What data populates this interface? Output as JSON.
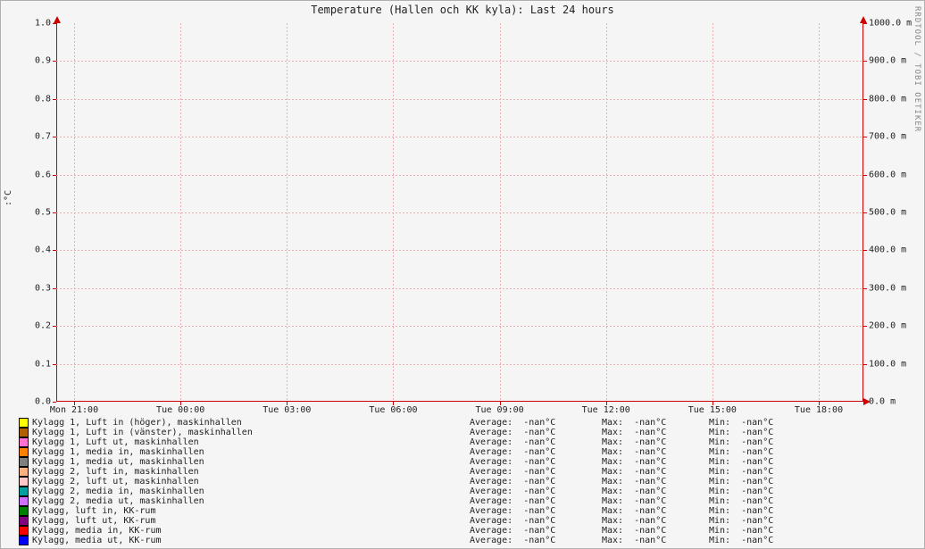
{
  "title": "Temperature (Hallen och KK kyla): Last 24 hours",
  "ylabel": ":°C",
  "watermark": "RRDTOOL / TOBI OETIKER",
  "y_left": [
    "0.0",
    "0.1",
    "0.2",
    "0.3",
    "0.4",
    "0.5",
    "0.6",
    "0.7",
    "0.8",
    "0.9",
    "1.0"
  ],
  "y_right": [
    "0.0 m",
    "100.0 m",
    "200.0 m",
    "300.0 m",
    "400.0 m",
    "500.0 m",
    "600.0 m",
    "700.0 m",
    "800.0 m",
    "900.0 m",
    "1000.0 m"
  ],
  "x_ticks": [
    "Mon 21:00",
    "Tue 00:00",
    "Tue 03:00",
    "Tue 06:00",
    "Tue 09:00",
    "Tue 12:00",
    "Tue 15:00",
    "Tue 18:00"
  ],
  "stat_headers": {
    "avg": "Average:",
    "max": "Max:",
    "min": "Min:"
  },
  "series": [
    {
      "color": "#ffff00",
      "name": "Kylagg 1, Luft in (höger), maskinhallen",
      "avg": "-nan°C",
      "max": "-nan°C",
      "min": "-nan°C"
    },
    {
      "color": "#b06000",
      "name": "Kylagg 1, Luft in (vänster), maskinhallen",
      "avg": "-nan°C",
      "max": "-nan°C",
      "min": "-nan°C"
    },
    {
      "color": "#ff70d0",
      "name": "Kylagg 1, Luft ut, maskinhallen",
      "avg": "-nan°C",
      "max": "-nan°C",
      "min": "-nan°C"
    },
    {
      "color": "#ff8000",
      "name": "Kylagg 1, media in, maskinhallen",
      "avg": "-nan°C",
      "max": "-nan°C",
      "min": "-nan°C"
    },
    {
      "color": "#808080",
      "name": "Kylagg 1, media ut, maskinhallen",
      "avg": "-nan°C",
      "max": "-nan°C",
      "min": "-nan°C"
    },
    {
      "color": "#ffb080",
      "name": "Kylagg 2, luft in, maskinhallen",
      "avg": "-nan°C",
      "max": "-nan°C",
      "min": "-nan°C"
    },
    {
      "color": "#ffc8c8",
      "name": "Kylagg 2, luft ut, maskinhallen",
      "avg": "-nan°C",
      "max": "-nan°C",
      "min": "-nan°C"
    },
    {
      "color": "#00a0a0",
      "name": "Kylagg 2, media in, maskinhallen",
      "avg": "-nan°C",
      "max": "-nan°C",
      "min": "-nan°C"
    },
    {
      "color": "#d070ff",
      "name": "Kylagg 2, media ut, maskinhallen",
      "avg": "-nan°C",
      "max": "-nan°C",
      "min": "-nan°C"
    },
    {
      "color": "#008000",
      "name": "Kylagg, luft in, KK-rum",
      "avg": "-nan°C",
      "max": "-nan°C",
      "min": "-nan°C"
    },
    {
      "color": "#800080",
      "name": "Kylagg, luft ut, KK-rum",
      "avg": "-nan°C",
      "max": "-nan°C",
      "min": "-nan°C"
    },
    {
      "color": "#ff0000",
      "name": "Kylagg, media in, KK-rum",
      "avg": "-nan°C",
      "max": "-nan°C",
      "min": "-nan°C"
    },
    {
      "color": "#0000ff",
      "name": "Kylagg, media ut, KK-rum",
      "avg": "-nan°C",
      "max": "-nan°C",
      "min": "-nan°C"
    }
  ],
  "chart_data": {
    "type": "line",
    "title": "Temperature (Hallen och KK kyla): Last 24 hours",
    "xlabel": "",
    "ylabel": ":°C",
    "x_categories": [
      "Mon 21:00",
      "Tue 00:00",
      "Tue 03:00",
      "Tue 06:00",
      "Tue 09:00",
      "Tue 12:00",
      "Tue 15:00",
      "Tue 18:00"
    ],
    "ylim_left": [
      0.0,
      1.0
    ],
    "ylim_right_label_suffix": " m",
    "ylim_right": [
      0.0,
      1000.0
    ],
    "series": [
      {
        "name": "Kylagg 1, Luft in (höger), maskinhallen",
        "values": null,
        "average": "-nan",
        "max": "-nan",
        "min": "-nan",
        "unit": "°C"
      },
      {
        "name": "Kylagg 1, Luft in (vänster), maskinhallen",
        "values": null,
        "average": "-nan",
        "max": "-nan",
        "min": "-nan",
        "unit": "°C"
      },
      {
        "name": "Kylagg 1, Luft ut, maskinhallen",
        "values": null,
        "average": "-nan",
        "max": "-nan",
        "min": "-nan",
        "unit": "°C"
      },
      {
        "name": "Kylagg 1, media in, maskinhallen",
        "values": null,
        "average": "-nan",
        "max": "-nan",
        "min": "-nan",
        "unit": "°C"
      },
      {
        "name": "Kylagg 1, media ut, maskinhallen",
        "values": null,
        "average": "-nan",
        "max": "-nan",
        "min": "-nan",
        "unit": "°C"
      },
      {
        "name": "Kylagg 2, luft in, maskinhallen",
        "values": null,
        "average": "-nan",
        "max": "-nan",
        "min": "-nan",
        "unit": "°C"
      },
      {
        "name": "Kylagg 2, luft ut, maskinhallen",
        "values": null,
        "average": "-nan",
        "max": "-nan",
        "min": "-nan",
        "unit": "°C"
      },
      {
        "name": "Kylagg 2, media in, maskinhallen",
        "values": null,
        "average": "-nan",
        "max": "-nan",
        "min": "-nan",
        "unit": "°C"
      },
      {
        "name": "Kylagg 2, media ut, maskinhallen",
        "values": null,
        "average": "-nan",
        "max": "-nan",
        "min": "-nan",
        "unit": "°C"
      },
      {
        "name": "Kylagg, luft in, KK-rum",
        "values": null,
        "average": "-nan",
        "max": "-nan",
        "min": "-nan",
        "unit": "°C"
      },
      {
        "name": "Kylagg, luft ut, KK-rum",
        "values": null,
        "average": "-nan",
        "max": "-nan",
        "min": "-nan",
        "unit": "°C"
      },
      {
        "name": "Kylagg, media in, KK-rum",
        "values": null,
        "average": "-nan",
        "max": "-nan",
        "min": "-nan",
        "unit": "°C"
      },
      {
        "name": "Kylagg, media ut, KK-rum",
        "values": null,
        "average": "-nan",
        "max": "-nan",
        "min": "-nan",
        "unit": "°C"
      }
    ],
    "note": "All series are NaN over the 24h window; no data points are plotted."
  }
}
